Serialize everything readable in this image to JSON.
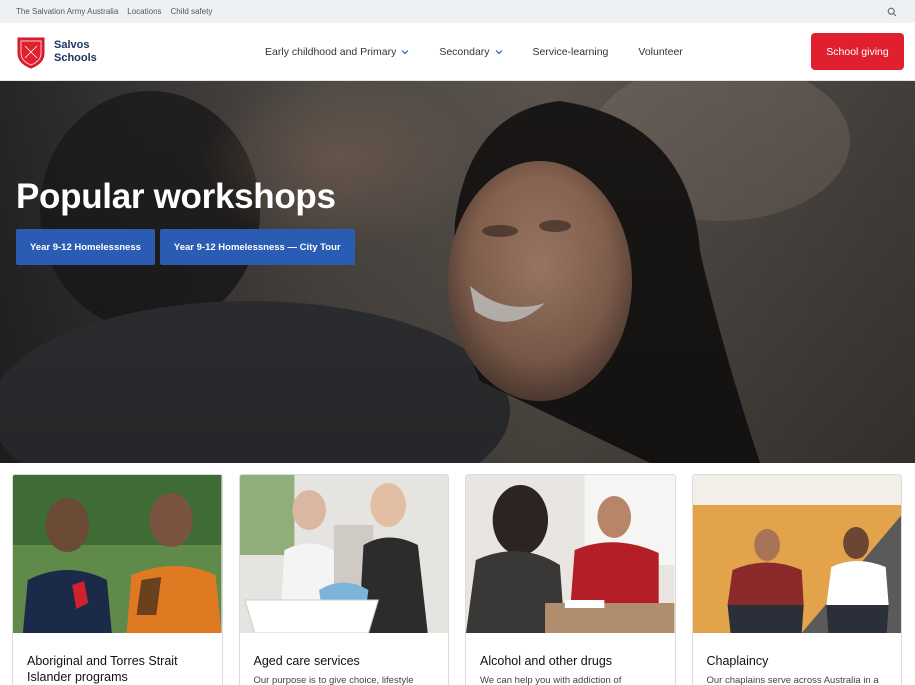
{
  "utility": {
    "links": [
      "The Salvation Army Australia",
      "Locations",
      "Child safety"
    ]
  },
  "header": {
    "logo_line1": "Salvos",
    "logo_line2": "Schools",
    "nav": [
      {
        "label": "Early childhood and Primary",
        "has_dropdown": true
      },
      {
        "label": "Secondary",
        "has_dropdown": true
      },
      {
        "label": "Service-learning",
        "has_dropdown": false
      },
      {
        "label": "Volunteer",
        "has_dropdown": false
      }
    ],
    "cta_label": "School giving"
  },
  "hero": {
    "title": "Popular workshops",
    "buttons": [
      "Year 9-12 Homelessness",
      "Year 9-12 Homelessness — City Tour"
    ]
  },
  "cards": [
    {
      "title": "Aboriginal and Torres Strait Islander programs",
      "desc": ""
    },
    {
      "title": "Aged care services",
      "desc": "Our purpose is to give choice, lifestyle"
    },
    {
      "title": "Alcohol and other drugs",
      "desc": "We can help you with addiction of"
    },
    {
      "title": "Chaplaincy",
      "desc": "Our chaplains serve across Australia in a"
    }
  ],
  "colors": {
    "brand_red": "#e0202e",
    "brand_navy": "#1d3461",
    "button_blue": "#2b5cb3"
  },
  "icons": {
    "search": "search-icon",
    "dropdown": "chevron-down-icon",
    "logo": "salvation-army-shield-icon"
  }
}
